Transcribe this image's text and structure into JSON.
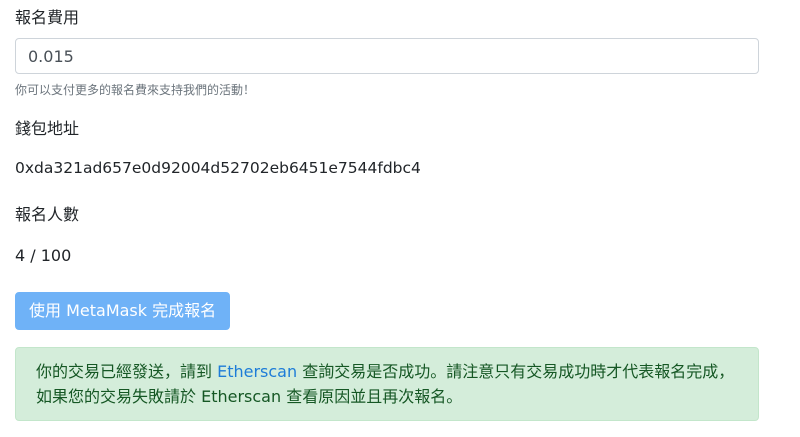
{
  "fee": {
    "label": "報名費用",
    "value": "0.015",
    "help": "你可以支付更多的報名費來支持我們的活動！"
  },
  "wallet": {
    "label": "錢包地址",
    "address": "0xda321ad657e0d92004d52702eb6451e7544fdbc4"
  },
  "registrants": {
    "label": "報名人數",
    "value": "4 / 100"
  },
  "submit_button": {
    "label": "使用 MetaMask 完成報名"
  },
  "alert": {
    "before_link": "你的交易已經發送，請到 ",
    "link_text": "Etherscan",
    "after_link": " 查詢交易是否成功。請注意只有交易成功時才代表報名完成，如果您的交易失敗請於 Etherscan 查看原因並且再次報名。"
  },
  "colors": {
    "button_bg": "#6fb2f7",
    "alert_bg": "#d4edda",
    "alert_text": "#155724",
    "link": "#1d7cd8"
  }
}
